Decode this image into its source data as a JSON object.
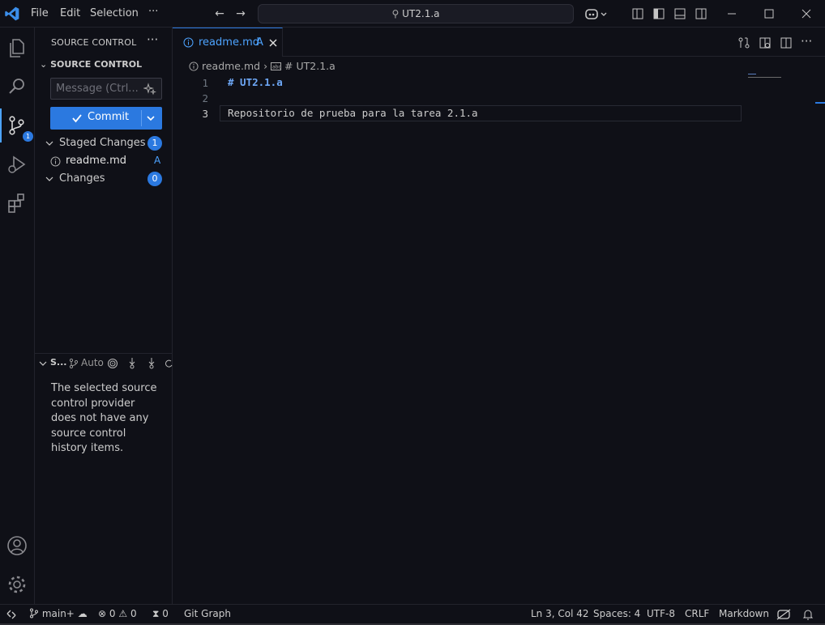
{
  "titlebar": {
    "menus": [
      "File",
      "Edit",
      "Selection"
    ],
    "more": "···",
    "search_text": "UT2.1.a"
  },
  "activity": {
    "scm_badge": "1"
  },
  "sidebar": {
    "title": "SOURCE CONTROL",
    "section": "SOURCE CONTROL",
    "message_placeholder": "Message (Ctrl...",
    "commit_label": "Commit",
    "staged_label": "Staged Changes",
    "staged_count": "1",
    "staged_file": "readme.md",
    "staged_file_status": "A",
    "changes_label": "Changes",
    "changes_count": "0",
    "history_title": "S...",
    "history_auto": "Auto",
    "history_empty": "The selected source control provider does not have any source control history items."
  },
  "editor": {
    "tab_label": "readme.md",
    "tab_status": "A",
    "breadcrumb_file": "readme.md",
    "breadcrumb_symbol": "# UT2.1.a",
    "lines": [
      {
        "num": "1",
        "text": "# UT2.1.a"
      },
      {
        "num": "2",
        "text": ""
      },
      {
        "num": "3",
        "text": "Repositorio de prueba para la tarea 2.1.a"
      }
    ]
  },
  "statusbar": {
    "branch": "main+",
    "errors": "0",
    "warnings": "0",
    "ports": "0",
    "git_graph": "Git Graph",
    "position": "Ln 3, Col 42",
    "spaces": "Spaces: 4",
    "encoding": "UTF-8",
    "eol": "CRLF",
    "language": "Markdown"
  },
  "colors": {
    "accent": "#2b79e0",
    "background": "#0f1017"
  }
}
